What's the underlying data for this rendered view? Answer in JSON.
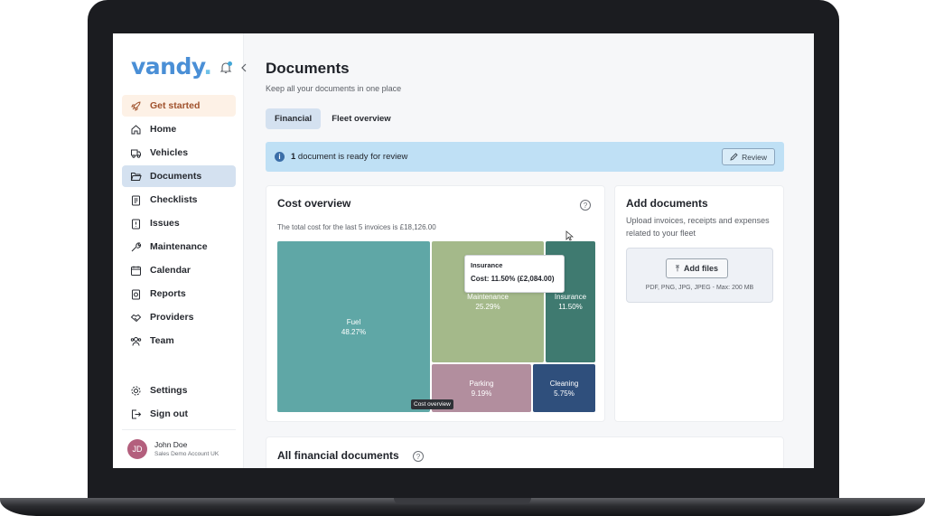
{
  "sidebar": {
    "logo": "vandy",
    "logo_dot": ".",
    "nav": [
      {
        "label": "Get started",
        "icon": "rocket-icon"
      },
      {
        "label": "Home",
        "icon": "home-icon"
      },
      {
        "label": "Vehicles",
        "icon": "vehicle-icon"
      },
      {
        "label": "Documents",
        "icon": "folder-icon"
      },
      {
        "label": "Checklists",
        "icon": "checklist-icon"
      },
      {
        "label": "Issues",
        "icon": "issue-icon"
      },
      {
        "label": "Maintenance",
        "icon": "wrench-icon"
      },
      {
        "label": "Calendar",
        "icon": "calendar-icon"
      },
      {
        "label": "Reports",
        "icon": "report-icon"
      },
      {
        "label": "Providers",
        "icon": "handshake-icon"
      },
      {
        "label": "Team",
        "icon": "team-icon"
      }
    ],
    "bottom": [
      {
        "label": "Settings",
        "icon": "gear-icon"
      },
      {
        "label": "Sign out",
        "icon": "sign-out-icon"
      }
    ],
    "user": {
      "initials": "JD",
      "name": "John Doe",
      "account": "Sales Demo Account UK"
    }
  },
  "header": {
    "title": "Documents",
    "subtitle": "Keep all your documents in one place"
  },
  "tabs": [
    {
      "label": "Financial",
      "active": true
    },
    {
      "label": "Fleet overview",
      "active": false
    }
  ],
  "banner": {
    "count": "1",
    "text": " document is ready for review",
    "button": "Review"
  },
  "cost_overview": {
    "title": "Cost overview",
    "subtitle": "The total cost for the last 5 invoices is £18,126.00",
    "tooltip": {
      "title": "Insurance",
      "value": "Cost: 11.50% (£2,084.00)"
    },
    "chart_tag": "Cost overview"
  },
  "chart_data": {
    "type": "treemap",
    "title": "Cost overview",
    "total": "£18,126.00",
    "items": [
      {
        "label": "Fuel",
        "percent": 48.27,
        "display": "48.27%",
        "color": "#5fa7a6"
      },
      {
        "label": "Maintenance",
        "percent": 25.29,
        "display": "25.29%",
        "color": "#a4b98a"
      },
      {
        "label": "Insurance",
        "percent": 11.5,
        "display": "11.50%",
        "color": "#3f7a70"
      },
      {
        "label": "Parking",
        "percent": 9.19,
        "display": "9.19%",
        "color": "#b28e9e"
      },
      {
        "label": "Cleaning",
        "percent": 5.75,
        "display": "5.75%",
        "color": "#2f4f7c"
      }
    ]
  },
  "add_documents": {
    "title": "Add documents",
    "subtitle": "Upload invoices, receipts and expenses related to your fleet",
    "button": "Add files",
    "formats": "PDF, PNG, JPG, JPEG - Max: 200 MB"
  },
  "all_docs": {
    "title": "All financial documents"
  }
}
